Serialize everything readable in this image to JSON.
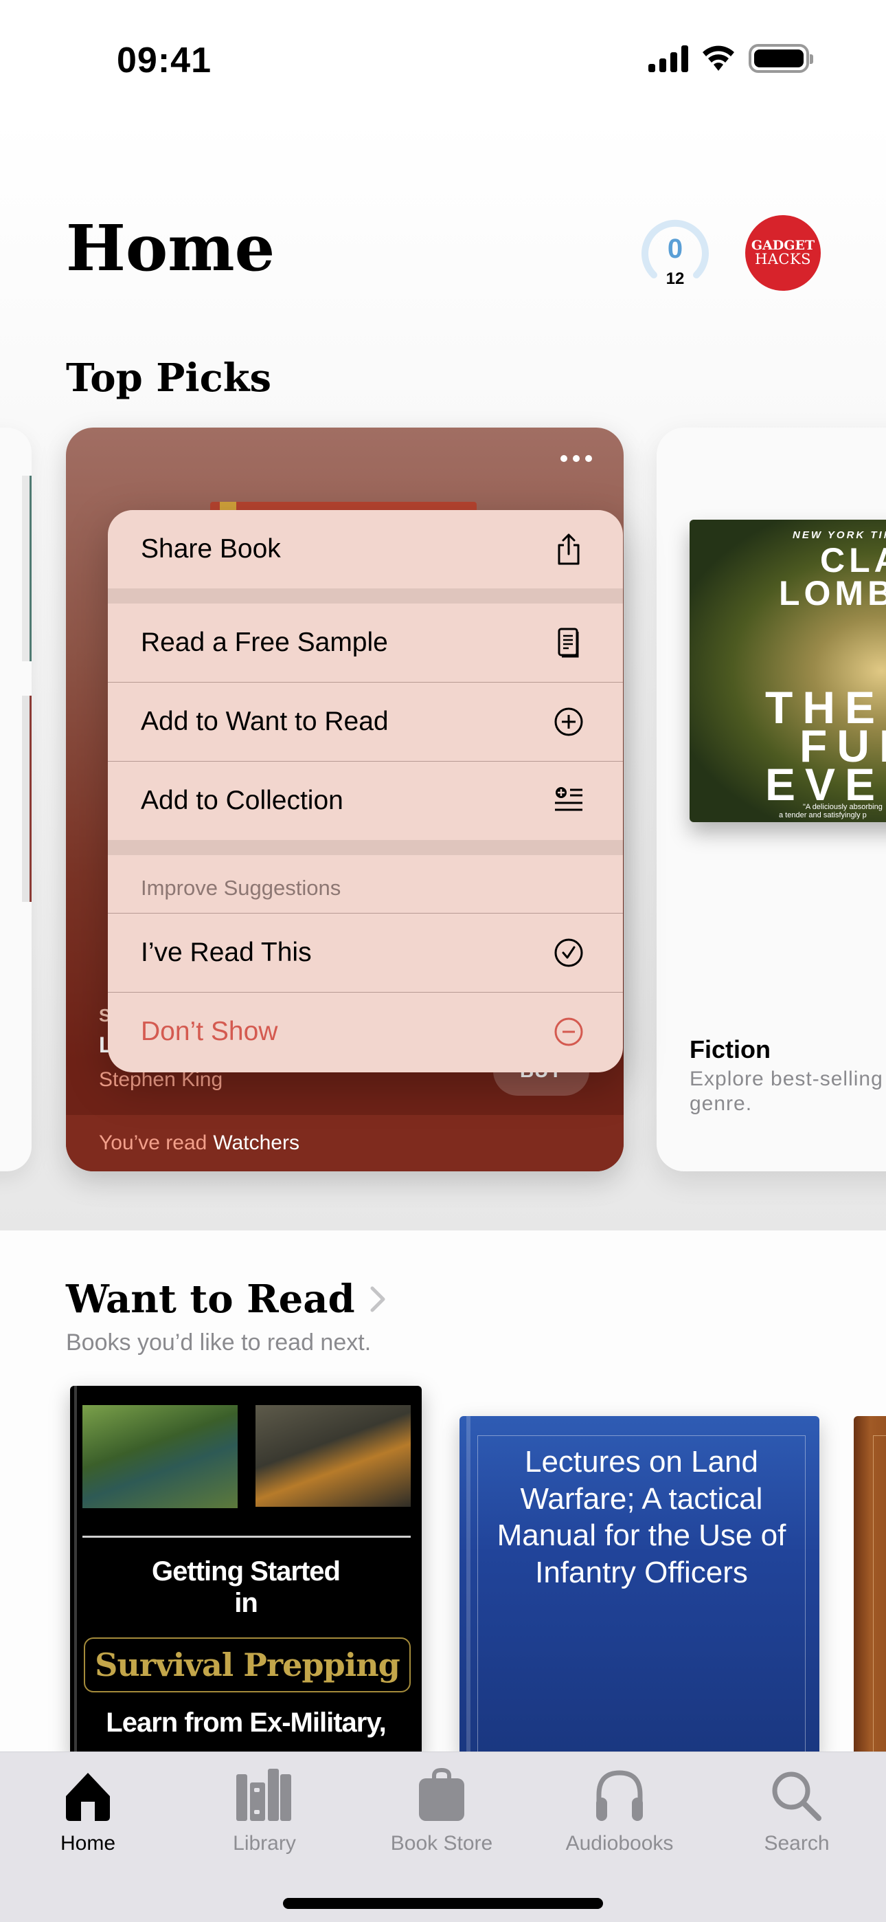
{
  "status_bar": {
    "time": "09:41"
  },
  "header": {
    "title": "Home",
    "reading_goal": {
      "current": "0",
      "target": "12",
      "progress": 0
    },
    "avatar": {
      "line1": "GADGET",
      "line2": "HACKS",
      "color": "#d7232b"
    }
  },
  "top_picks": {
    "title": "Top Picks",
    "main_card": {
      "series_initial": "S",
      "title_initial": "L",
      "author": "Stephen King",
      "buy_label": "BUY",
      "footer_prefix": "You’ve read",
      "footer_book": "Watchers",
      "background": "#7a3426"
    },
    "right_card": {
      "cover": {
        "badge": "NEW YORK TIMES",
        "author_line1": "CLA",
        "author_line2": "LOMB",
        "title_line1": "THE I",
        "title_line2": "FUN",
        "title_line3": "EVER",
        "quote_line1": "\"A deliciously absorbing",
        "quote_line2": "a tender and satisfyingly p"
      },
      "genre": "Fiction",
      "description": "Explore best-selling genre."
    }
  },
  "context_menu": {
    "items": [
      {
        "label": "Share Book",
        "icon": "share-icon"
      },
      {
        "label": "Read a Free Sample",
        "icon": "sample-pages-icon"
      },
      {
        "label": "Add to Want to Read",
        "icon": "plus-circle-icon"
      },
      {
        "label": "Add to Collection",
        "icon": "add-to-list-icon"
      }
    ],
    "section_header": "Improve Suggestions",
    "suggestion_items": [
      {
        "label": "I’ve Read This",
        "icon": "checkmark-circle-icon"
      },
      {
        "label": "Don’t Show",
        "icon": "minus-circle-icon",
        "destructive": true
      }
    ],
    "destructive_color": "#d45a50"
  },
  "want_to_read": {
    "title": "Want to Read",
    "subtitle": "Books you’d like to read next.",
    "books": [
      {
        "line1": "Getting Started",
        "line2": "in",
        "highlight": "Survival Prepping",
        "line3": "Learn from Ex-Military,"
      },
      {
        "title": "Lectures on Land Warfare; A tactical Manual for the Use of Infantry Officers"
      }
    ]
  },
  "tab_bar": {
    "tabs": [
      {
        "label": "Home",
        "icon": "home-icon",
        "active": true
      },
      {
        "label": "Library",
        "icon": "library-icon",
        "active": false
      },
      {
        "label": "Book Store",
        "icon": "bag-icon",
        "active": false
      },
      {
        "label": "Audiobooks",
        "icon": "headphones-icon",
        "active": false
      },
      {
        "label": "Search",
        "icon": "search-icon",
        "active": false
      }
    ]
  }
}
